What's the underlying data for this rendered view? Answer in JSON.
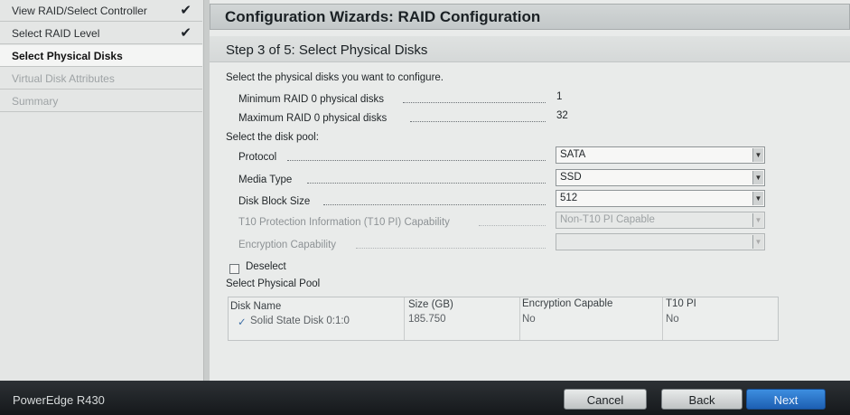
{
  "sidebar": {
    "items": [
      {
        "label": "View RAID/Select Controller",
        "checked": true
      },
      {
        "label": "Select RAID Level",
        "checked": true
      },
      {
        "label": "Select Physical Disks",
        "active": true
      },
      {
        "label": "Virtual Disk Attributes",
        "disabled": true
      },
      {
        "label": "Summary",
        "disabled": true
      }
    ],
    "check_glyph": "✔"
  },
  "header": {
    "title": "Configuration Wizards: RAID Configuration",
    "step_title": "Step 3 of 5: Select Physical Disks"
  },
  "form": {
    "instruction": "Select the physical disks you want to configure.",
    "min_label": "Minimum RAID 0 physical disks",
    "min_value": "1",
    "max_label": "Maximum RAID 0 physical disks",
    "max_value": "32",
    "pool_heading": "Select the disk pool:",
    "protocol_label": "Protocol",
    "protocol_value": "SATA",
    "media_label": "Media Type",
    "media_value": "SSD",
    "block_label": "Disk Block Size",
    "block_value": "512",
    "t10_label": "T10 Protection Information (T10 PI) Capability",
    "t10_value": "Non-T10 PI Capable",
    "enc_label": "Encryption Capability",
    "enc_value": "",
    "deselect_label": "Deselect",
    "physical_pool_heading": "Select Physical Pool"
  },
  "table": {
    "headers": [
      "Disk Name",
      "Size (GB)",
      "Encryption Capable",
      "T10 PI"
    ],
    "rows": [
      {
        "name": "Solid State Disk 0:1:0",
        "size": "185.750",
        "encryption": "No",
        "t10": "No"
      }
    ],
    "row_check_glyph": "✓"
  },
  "footer": {
    "model": "PowerEdge R430",
    "cancel": "Cancel",
    "back": "Back",
    "next": "Next"
  },
  "colors": {
    "accent_blue": "#2a73c8",
    "footer_bg": "#1e2226"
  }
}
